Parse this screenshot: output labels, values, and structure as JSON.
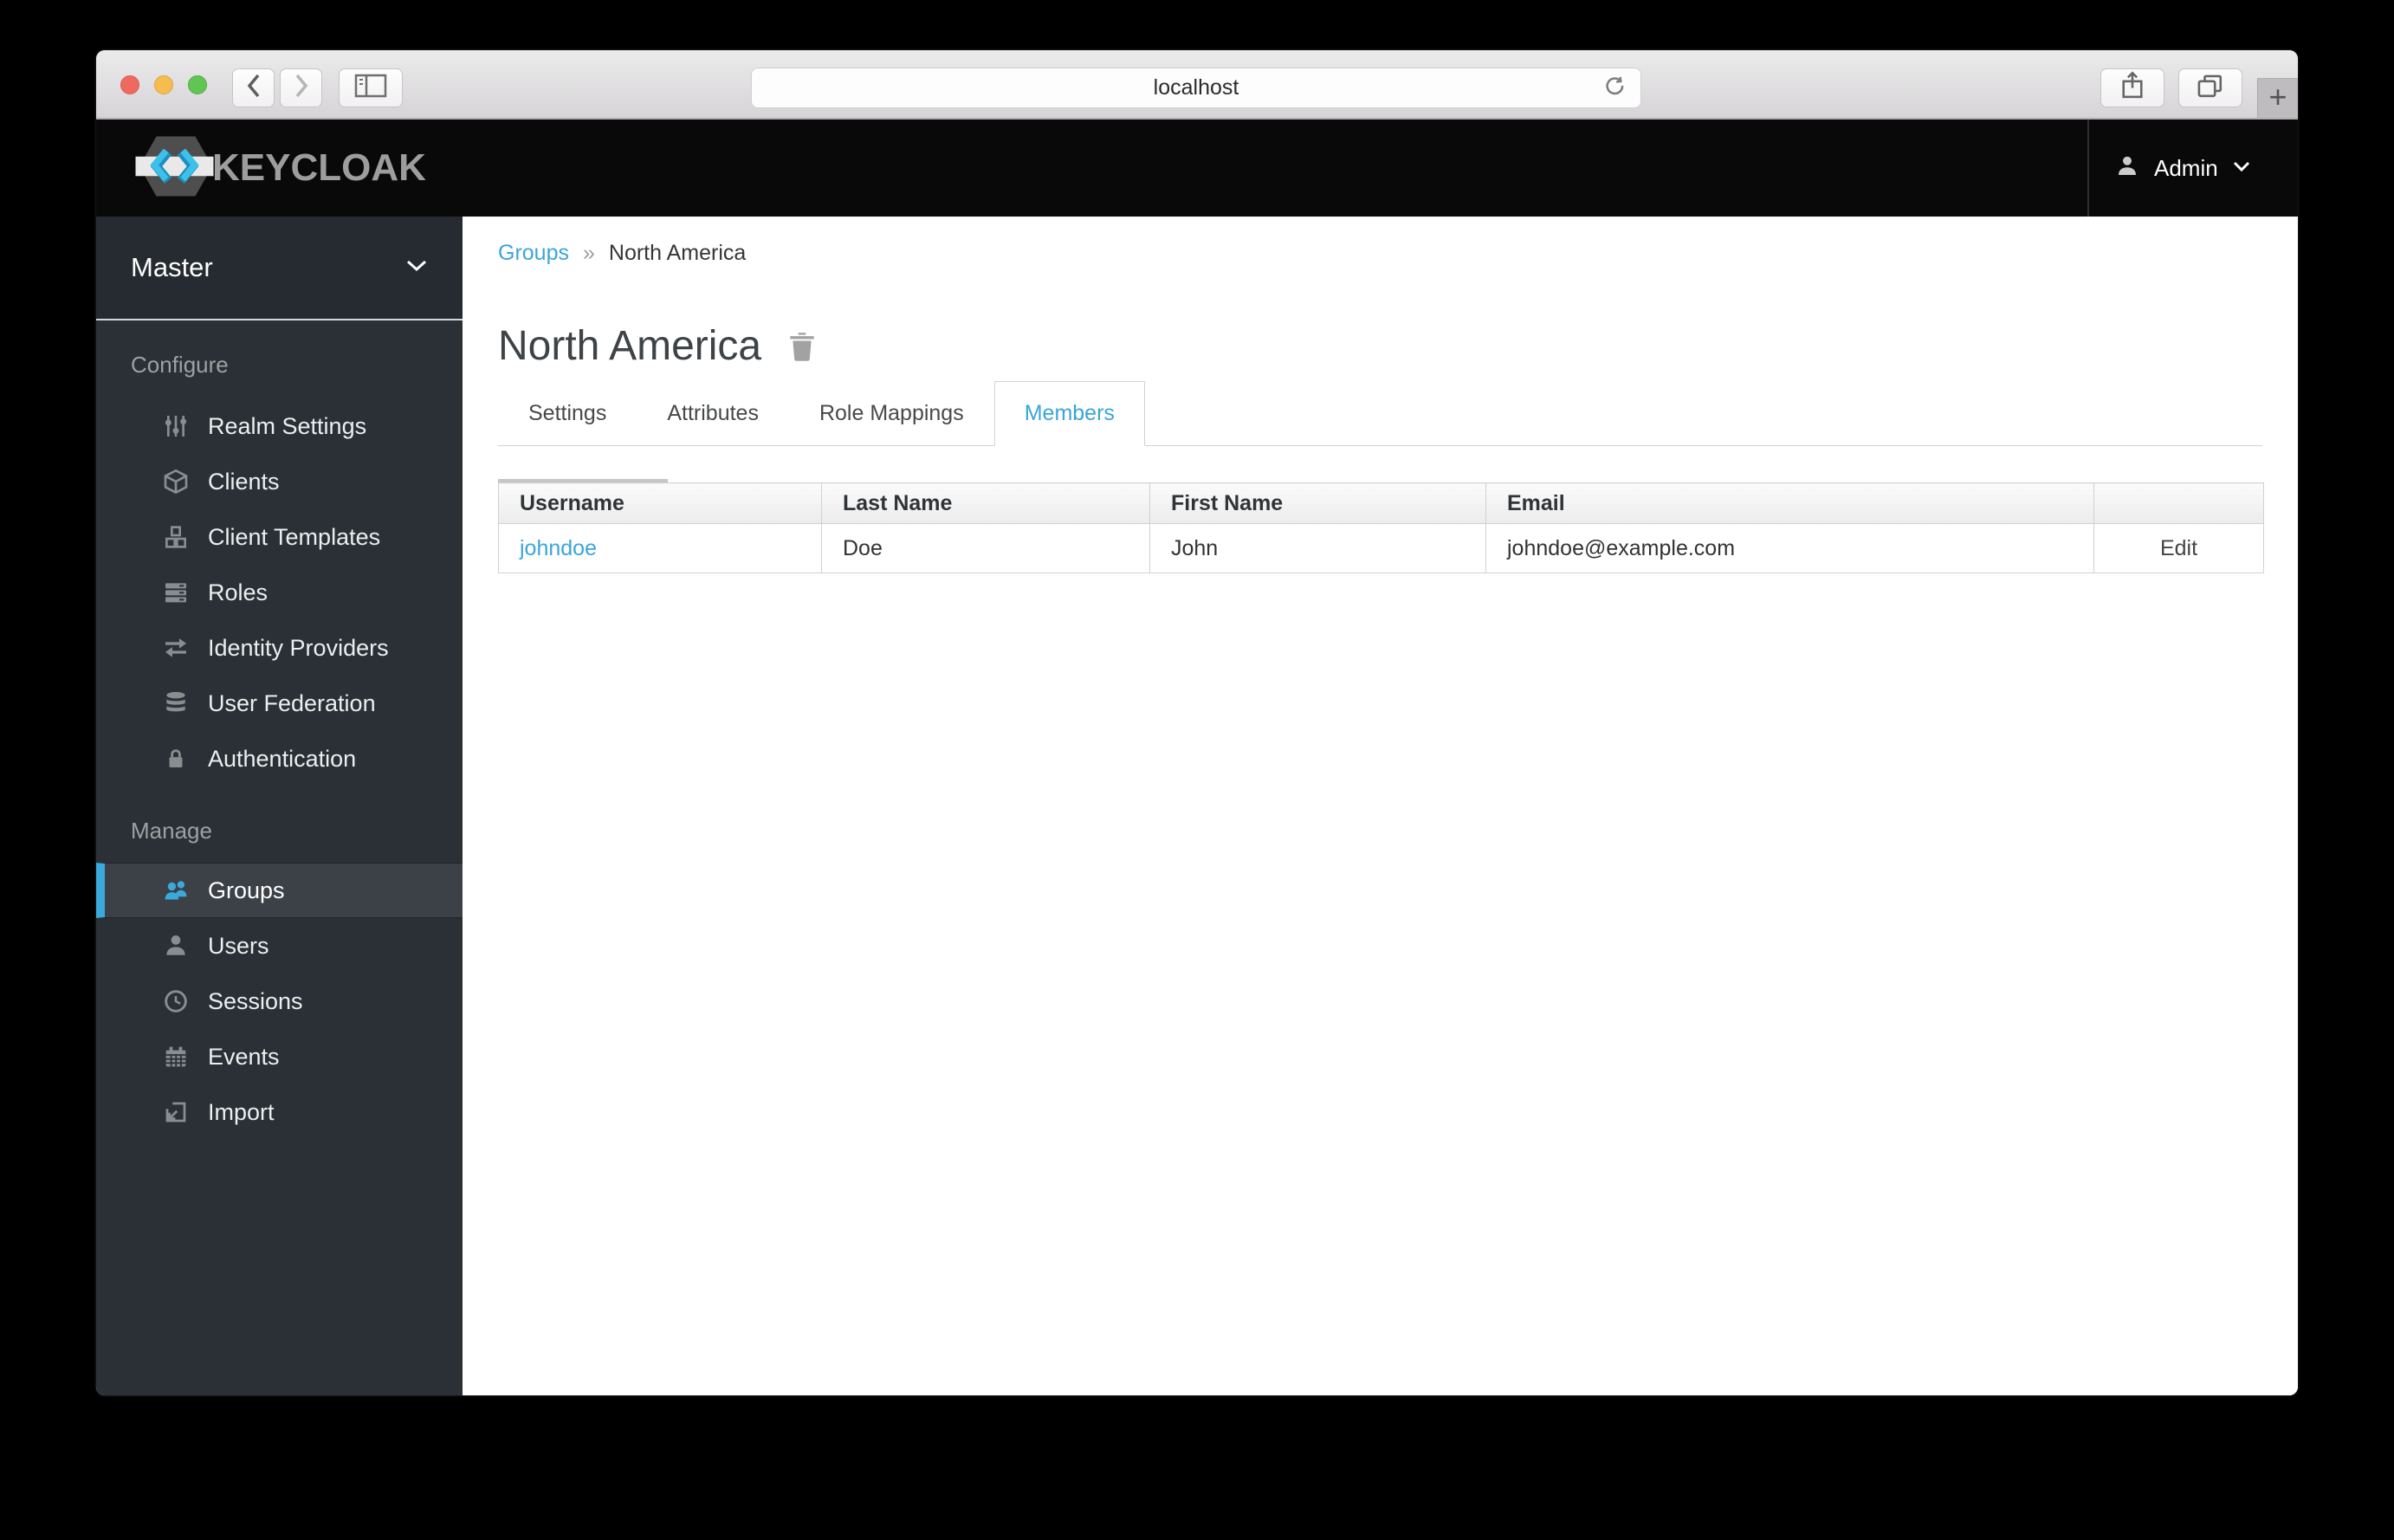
{
  "browser": {
    "url": "localhost",
    "new_tab_label": "+",
    "window_controls": [
      "close",
      "minimize",
      "zoom"
    ]
  },
  "header": {
    "brand": "KEYCLOAK",
    "user_label": "Admin"
  },
  "sidebar": {
    "realm": "Master",
    "sections": [
      {
        "label": "Configure",
        "items": [
          {
            "label": "Realm Settings",
            "icon": "sliders-icon"
          },
          {
            "label": "Clients",
            "icon": "cube-icon"
          },
          {
            "label": "Client Templates",
            "icon": "cubes-icon"
          },
          {
            "label": "Roles",
            "icon": "list-bars-icon"
          },
          {
            "label": "Identity Providers",
            "icon": "exchange-arrows-icon"
          },
          {
            "label": "User Federation",
            "icon": "database-icon"
          },
          {
            "label": "Authentication",
            "icon": "lock-icon"
          }
        ]
      },
      {
        "label": "Manage",
        "items": [
          {
            "label": "Groups",
            "icon": "users-group-icon",
            "selected": true
          },
          {
            "label": "Users",
            "icon": "user-icon",
            "selected": false
          },
          {
            "label": "Sessions",
            "icon": "clock-icon",
            "selected": false
          },
          {
            "label": "Events",
            "icon": "calendar-icon",
            "selected": false
          },
          {
            "label": "Import",
            "icon": "import-icon",
            "selected": false
          }
        ]
      }
    ]
  },
  "main": {
    "breadcrumb": {
      "parent": "Groups",
      "separator": "»",
      "current": "North America"
    },
    "title": "North America",
    "tabs": [
      {
        "label": "Settings",
        "active": false
      },
      {
        "label": "Attributes",
        "active": false
      },
      {
        "label": "Role Mappings",
        "active": false
      },
      {
        "label": "Members",
        "active": true
      }
    ],
    "members_table": {
      "columns": [
        "Username",
        "Last Name",
        "First Name",
        "Email",
        ""
      ],
      "rows": [
        {
          "username": "johndoe",
          "last_name": "Doe",
          "first_name": "John",
          "email": "johndoe@example.com",
          "action": "Edit"
        }
      ]
    }
  },
  "colors": {
    "accent_blue": "#39a5d9",
    "selected_indicator": "#3aa9dc",
    "sidebar_bg": "#2b3036",
    "header_bg": "#090909",
    "table_border": "#d1d1d1",
    "traffic_red": "#ee6a5f",
    "traffic_yellow": "#f5bd4f",
    "traffic_green": "#61c554"
  }
}
